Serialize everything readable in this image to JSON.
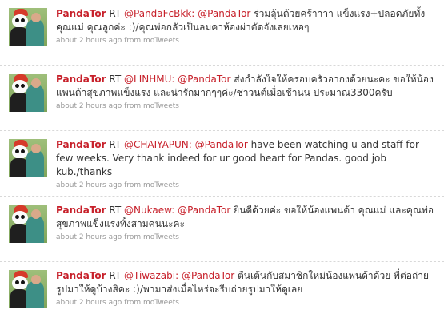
{
  "tweets": [
    {
      "author": "PandaTor",
      "rt": "RT",
      "mention1": "@PandaFcBkk:",
      "mention2": "@PandaTor",
      "text": "ร่วมลุ้นด้วยคร้าาาา แข็งแรง+ปลอดภัยทั้งคุณแม่ คุณลูกค่ะ :)/คุณพ่อกลัวเป็นลมคาห้องผ่าตัดจังเลยเหอๆ",
      "time": "about 2 hours ago",
      "from_prefix": "from",
      "source": "moTweets"
    },
    {
      "author": "PandaTor",
      "rt": "RT",
      "mention1": "@LINHMU:",
      "mention2": "@PandaTor",
      "text": "ส่งกำลังใจให้ครอบครัวอากงด้วยนะคะ ขอให้น้องแพนด้าสุขภาพแข็งแรง และน่ารักมากๆๆค่ะ/ชาวนต์เมื่อเช้านน ประมาณ3300ครับ",
      "time": "about 2 hours ago",
      "from_prefix": "from",
      "source": "moTweets"
    },
    {
      "author": "PandaTor",
      "rt": "RT",
      "mention1": "@CHAIYAPUN:",
      "mention2": "@PandaTor",
      "text": "have been watching u and staff for few weeks. Very thank indeed for ur good heart for Pandas. good job kub./thanks",
      "time": "about 2 hours ago",
      "from_prefix": "from",
      "source": "moTweets"
    },
    {
      "author": "PandaTor",
      "rt": "RT",
      "mention1": "@Nukaew:",
      "mention2": "@PandaTor",
      "text": "ยินดีด้วยค่ะ ขอให้น้องแพนด้า คุณแม่ และคุณพ่อ สุขภาพแข็งแรงทั้งสามคนนะคะ",
      "time": "about 2 hours ago",
      "from_prefix": "from",
      "source": "moTweets"
    },
    {
      "author": "PandaTor",
      "rt": "RT",
      "mention1": "@Tiwazabi:",
      "mention2": "@PandaTor",
      "text": "ตื่นเต้นกับสมาชิกใหม่น้องแพนด้าด้วย พี่ต่อถ่ายรูปมาให้ดูบ้างสิคะ :)/พามาส่งเมื่อไหร่จะรีบถ่ายรูปมาให้ดูเลย",
      "time": "about 2 hours ago",
      "from_prefix": "from",
      "source": "moTweets"
    }
  ]
}
